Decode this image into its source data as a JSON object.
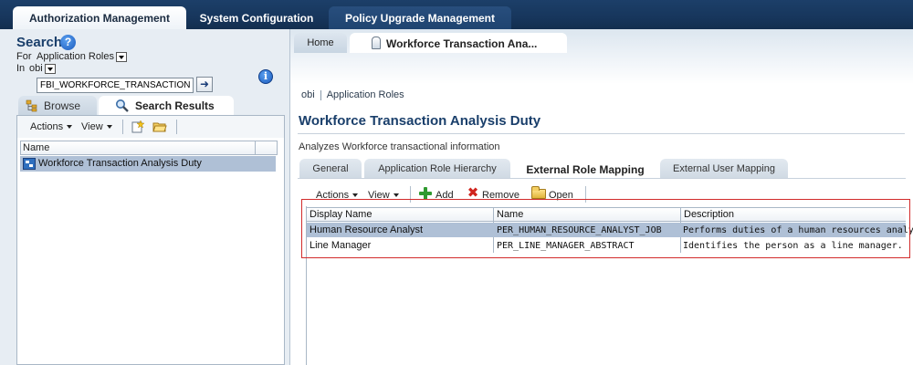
{
  "top_tabs": [
    {
      "label": "Authorization Management"
    },
    {
      "label": "System Configuration"
    },
    {
      "label": "Policy Upgrade Management"
    }
  ],
  "search_panel": {
    "title": "Search",
    "help_glyph": "?",
    "for_label": "For",
    "for_value": "Application Roles",
    "in_label": "In",
    "in_value": "obi",
    "search_value": "FBI_WORKFORCE_TRANSACTION_",
    "go_glyph": "➜",
    "tabs": [
      {
        "label": "Browse"
      },
      {
        "label": "Search Results"
      }
    ],
    "toolbar": {
      "actions": "Actions",
      "view": "View"
    },
    "column_header": "Name",
    "results": [
      {
        "name": "Workforce Transaction Analysis Duty",
        "selected": true
      }
    ],
    "info_glyph": "i"
  },
  "document_tabs": [
    {
      "label": "Home"
    },
    {
      "label": "Workforce Transaction Ana..."
    }
  ],
  "breadcrumb": {
    "item1": "obi",
    "item2": "Application Roles"
  },
  "page_title": "Workforce Transaction Analysis Duty",
  "page_description": "Analyzes Workforce transactional information",
  "content_tabs": [
    {
      "label": "General"
    },
    {
      "label": "Application Role Hierarchy"
    },
    {
      "label": "External Role Mapping"
    },
    {
      "label": "External User Mapping"
    }
  ],
  "mapping_toolbar": {
    "actions": "Actions",
    "view": "View",
    "add": "Add",
    "remove": "Remove",
    "open": "Open",
    "remove_glyph": "✖"
  },
  "mapping_table": {
    "columns": [
      "Display Name",
      "Name",
      "Description"
    ],
    "rows": [
      {
        "display_name": "Human Resource Analyst",
        "name": "PER_HUMAN_RESOURCE_ANALYST_JOB",
        "description": "Performs duties of a human resources analyst.",
        "selected": true
      },
      {
        "display_name": "Line Manager",
        "name": "PER_LINE_MANAGER_ABSTRACT",
        "description": "Identifies the person as a line manager.",
        "selected": false
      }
    ]
  },
  "colors": {
    "header_navy": "#17365c",
    "title_blue": "#1a3f6b",
    "selection": "#afc0d6",
    "highlight_red": "#d22b2b"
  }
}
